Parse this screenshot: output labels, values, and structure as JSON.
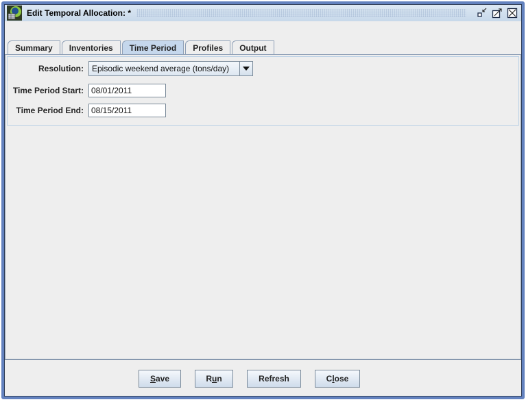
{
  "window": {
    "title": "Edit Temporal Allocation: *",
    "controls": [
      "minimize",
      "maximize",
      "close"
    ]
  },
  "tabs": [
    {
      "label": "Summary",
      "active": false
    },
    {
      "label": "Inventories",
      "active": false
    },
    {
      "label": "Time Period",
      "active": true
    },
    {
      "label": "Profiles",
      "active": false
    },
    {
      "label": "Output",
      "active": false
    }
  ],
  "form": {
    "resolution_label": "Resolution:",
    "resolution_value": "Episodic weekend average (tons/day)",
    "start_label": "Time Period Start:",
    "start_value": "08/01/2011",
    "end_label": "Time Period End:",
    "end_value": "08/15/2011"
  },
  "buttons": {
    "save": {
      "pre": "",
      "mnemonic": "S",
      "post": "ave"
    },
    "run": {
      "pre": "R",
      "mnemonic": "u",
      "post": "n"
    },
    "refresh": {
      "pre": "Refresh",
      "mnemonic": "",
      "post": ""
    },
    "close": {
      "pre": "C",
      "mnemonic": "l",
      "post": "ose"
    }
  },
  "colors": {
    "frame": "#6382bf",
    "active_tab": "#c5d7ec",
    "background": "#eeeeee"
  }
}
